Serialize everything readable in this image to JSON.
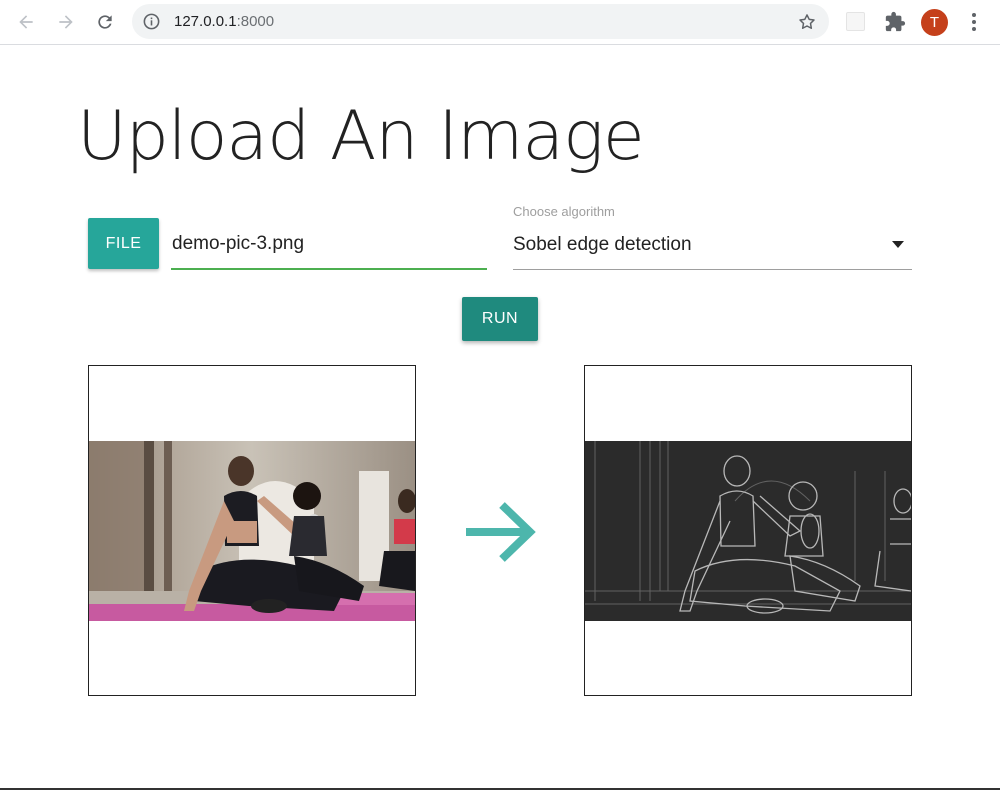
{
  "browser": {
    "url_host": "127.0.0.1",
    "url_port": ":8000",
    "profile_initial": "T",
    "colors": {
      "avatar": "#c5401b",
      "omnibox": "#f1f3f4"
    },
    "icons": [
      "back-icon",
      "forward-icon",
      "reload-icon",
      "site-info-icon",
      "bookmark-star-icon",
      "extension-icon",
      "extensions-puzzle-icon",
      "menu-kebab-icon"
    ]
  },
  "page": {
    "title": "Upload An Image",
    "file_button_label": "FILE",
    "file_name": "demo-pic-3.png",
    "algorithm_label": "Choose algorithm",
    "algorithm_value": "Sobel edge detection",
    "run_button_label": "RUN",
    "input_image": "yoga-photo",
    "output_image": "sobel-edge-result",
    "colors": {
      "accent": "#26a69a",
      "run_button": "#1f8a7e",
      "file_underline": "#4caf50",
      "arrow": "#4db6ac"
    }
  }
}
